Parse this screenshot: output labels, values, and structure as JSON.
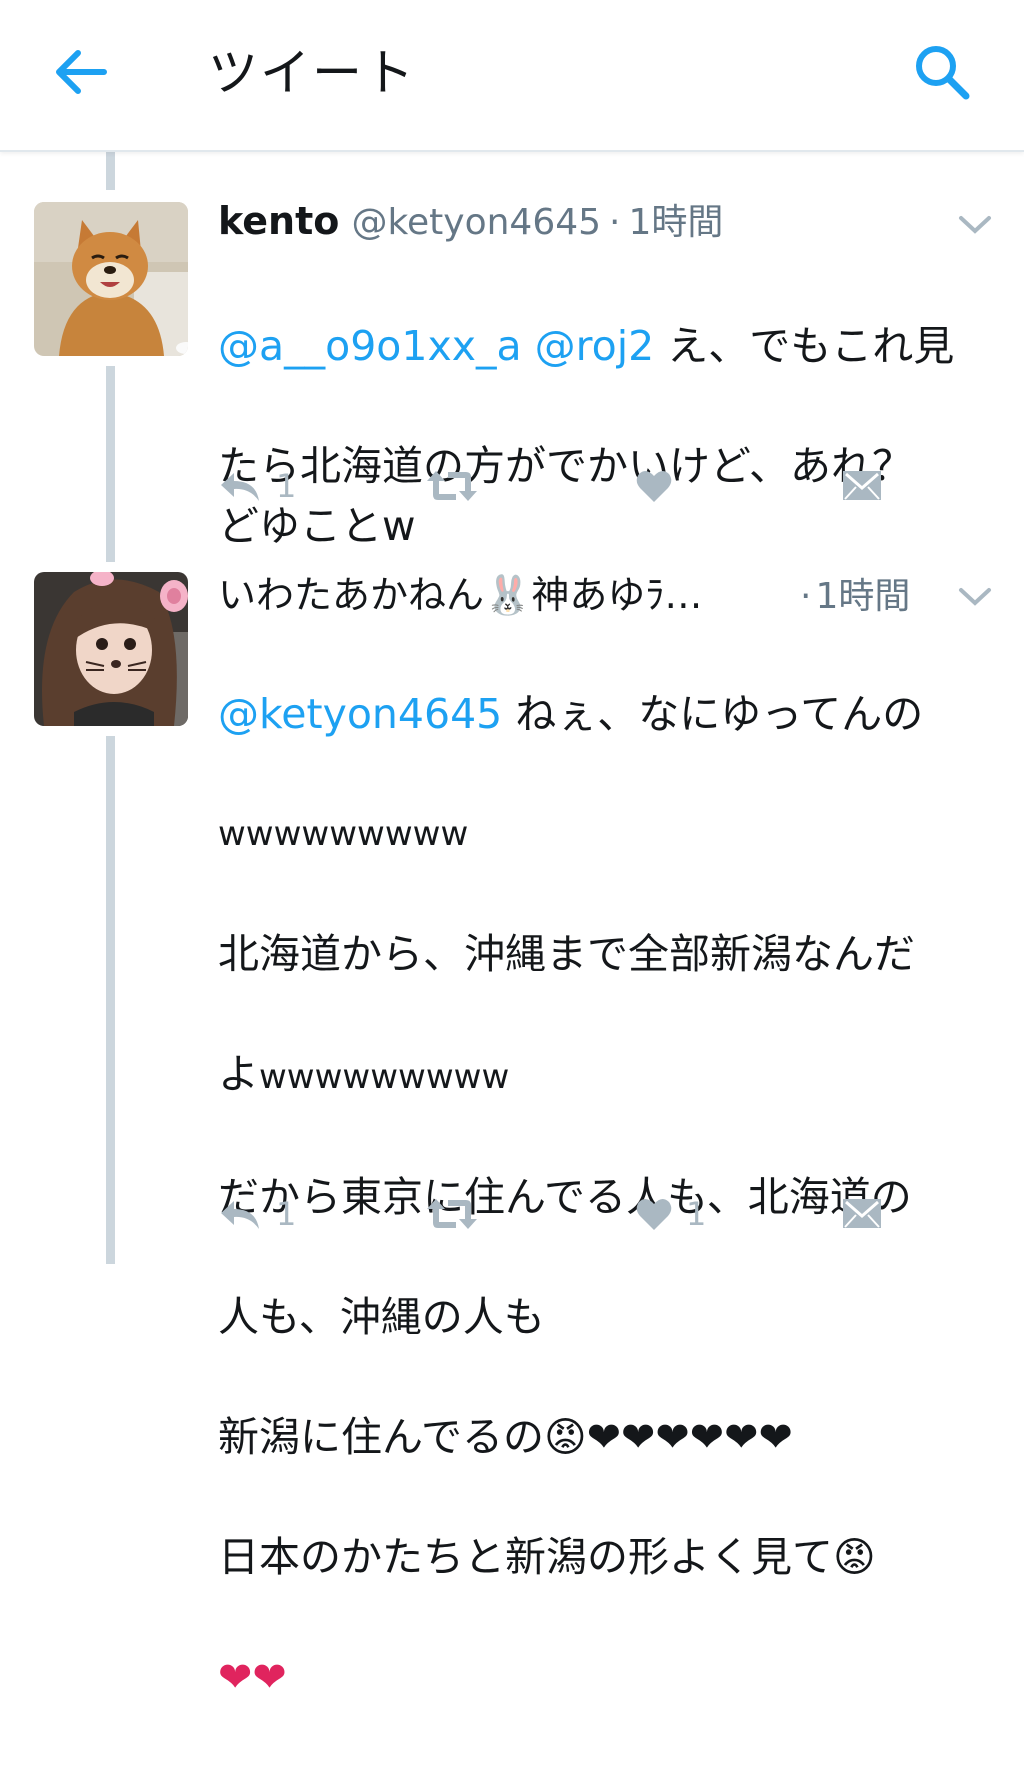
{
  "header": {
    "title": "ツイート",
    "back_icon": "arrow-left-icon",
    "search_icon": "search-icon",
    "accent": "#1da1f2"
  },
  "tweets": [
    {
      "name": "kento",
      "handle": "@ketyon4645",
      "separator": "·",
      "time": "1時間",
      "mentions": [
        "@a__o9o1xx_a",
        "@roj2"
      ],
      "text_line1_after": " え、でもこれ見",
      "text_rest": "たら北海道の方がでかいけど、あれ？\nどゆことw",
      "reply_count": "1",
      "retweet_count": "",
      "like_count": ""
    },
    {
      "name": "いわたあかねん🐰神あゆﾗ…",
      "separator": "·",
      "time": "1時間",
      "mention": "@ketyon4645",
      "after_mention": " ねぇ、なにゆってんの",
      "line2": "wwwwwwwww",
      "line3": "北海道から、沖縄まで全部新潟なんだ",
      "line4a": "よ",
      "line4b": "wwwwwwwww",
      "line5": "だから東京に住んでる人も、北海道の",
      "line6": "人も、沖縄の人も",
      "line7": "新潟に住んでるの😡❤❤❤❤❤❤",
      "line8": "日本のかたちと新潟の形よく見て😡",
      "line9": "❤❤",
      "reply_count": "1",
      "retweet_count": "",
      "like_count": "1"
    }
  ],
  "colors": {
    "icon_gray": "#aab8c2",
    "heart_gray": "#aab8c2",
    "thread_line": "#ccd6dd",
    "secondary_text": "#657786"
  }
}
